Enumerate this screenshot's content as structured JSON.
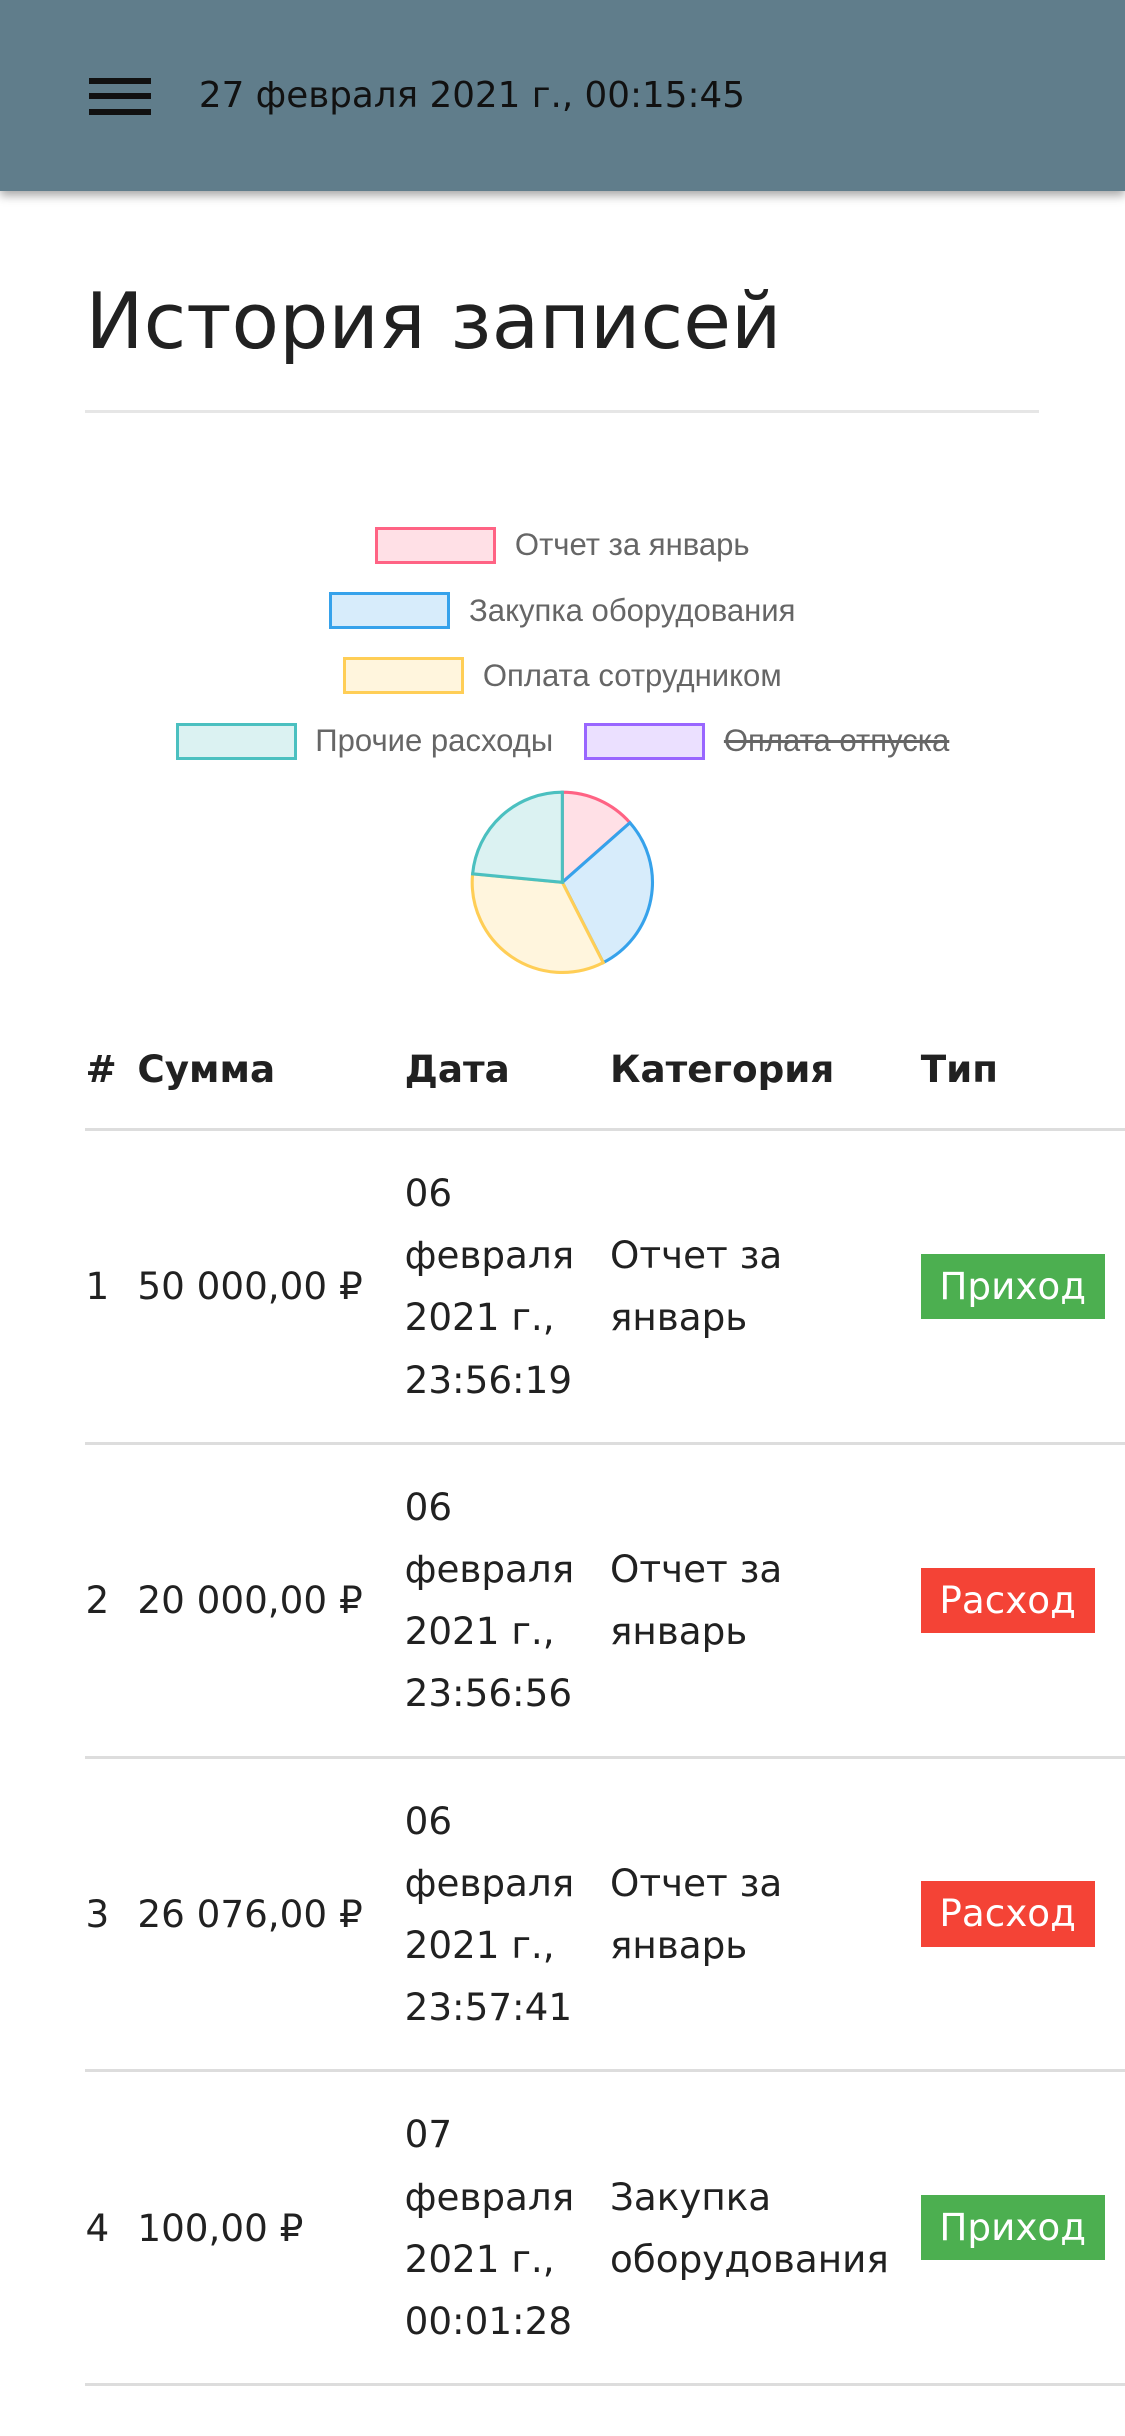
{
  "header": {
    "datetime": "27 февраля 2021 г., 00:15:45",
    "menu_icon": "hamburger-icon"
  },
  "page": {
    "title": "История записей"
  },
  "chart_data": {
    "type": "pie",
    "legend_placement": "top",
    "labels": [
      "Отчет за январь",
      "Закупка оборудования",
      "Оплата сотрудником",
      "Прочие расходы",
      "Оплата отпуска"
    ],
    "hidden": [
      false,
      false,
      false,
      false,
      true
    ],
    "values": [
      13.5,
      29,
      34,
      23.5,
      0
    ],
    "border_colors": [
      "#ff6384",
      "#36a2eb",
      "#ffce56",
      "#4bc0c0",
      "#9966ff"
    ],
    "fill_colors": [
      "#ffe0e6",
      "#d7ecfb",
      "#fff5dd",
      "#dbf2f2",
      "#ebe0ff"
    ]
  },
  "table": {
    "headers": [
      "#",
      "Сумма",
      "Дата",
      "Категория",
      "Тип"
    ],
    "rows": [
      {
        "n": "1",
        "sum": "50 000,00 ₽",
        "date": [
          "06",
          "февраля",
          "2021 г.,",
          "23:56:19"
        ],
        "cat": "Отчет за январь",
        "type": "Приход",
        "color": "#4caf50"
      },
      {
        "n": "2",
        "sum": "20 000,00 ₽",
        "date": [
          "06",
          "февраля",
          "2021 г.,",
          "23:56:56"
        ],
        "cat": "Отчет за январь",
        "type": "Расход",
        "color": "#f44336"
      },
      {
        "n": "3",
        "sum": "26 076,00 ₽",
        "date": [
          "06",
          "февраля",
          "2021 г.,",
          "23:57:41"
        ],
        "cat": "Отчет за январь",
        "type": "Расход",
        "color": "#f44336"
      },
      {
        "n": "4",
        "sum": "100,00 ₽",
        "date": [
          "07",
          "февраля",
          "2021 г.,",
          "00:01:28"
        ],
        "cat": "Закупка оборудования",
        "type": "Приход",
        "color": "#4caf50"
      }
    ]
  }
}
